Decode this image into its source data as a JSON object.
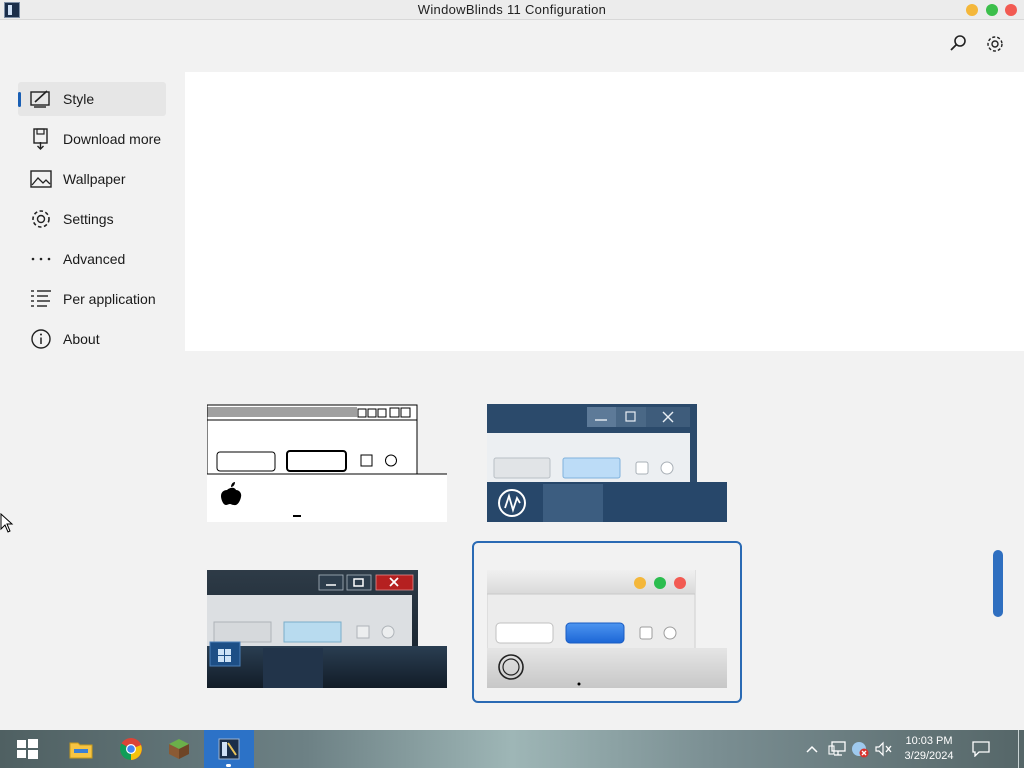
{
  "window": {
    "title": "WindowBlinds 11 Configuration"
  },
  "sidebar": {
    "items": [
      {
        "label": "Style",
        "icon": "pen-tablet-icon"
      },
      {
        "label": "Download more",
        "icon": "save-download-icon"
      },
      {
        "label": "Wallpaper",
        "icon": "image-icon"
      },
      {
        "label": "Settings",
        "icon": "gear-icon"
      },
      {
        "label": "Advanced",
        "icon": "more-dots-icon"
      },
      {
        "label": "Per application",
        "icon": "list-icon"
      },
      {
        "label": "About",
        "icon": "info-icon"
      }
    ],
    "active_index": 0
  },
  "thumbnails": [
    {
      "name": "classic-mac",
      "selected": false
    },
    {
      "name": "dark-blue-flat",
      "selected": false
    },
    {
      "name": "dark-aero",
      "selected": false
    },
    {
      "name": "mac-light",
      "selected": true
    }
  ],
  "taskbar": {
    "time": "10:03 PM",
    "date": "3/29/2024",
    "pinned": [
      "start-icon",
      "file-explorer-icon",
      "chrome-icon",
      "minecraft-icon",
      "windowblinds-icon"
    ],
    "active_app": "windowblinds-icon"
  },
  "colors": {
    "accent": "#2a6ab4",
    "window_bg": "#f2f2f2",
    "preview_bg": "#ffffff"
  }
}
